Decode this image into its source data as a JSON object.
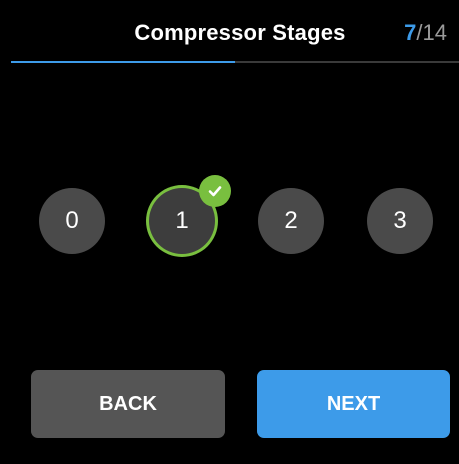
{
  "header": {
    "title": "Compressor Stages",
    "step_current": "7",
    "step_total": "/14",
    "progress_fraction": 0.5
  },
  "options": [
    {
      "label": "0",
      "selected": false
    },
    {
      "label": "1",
      "selected": true
    },
    {
      "label": "2",
      "selected": false
    },
    {
      "label": "3",
      "selected": false
    }
  ],
  "buttons": {
    "back_label": "BACK",
    "next_label": "NEXT"
  },
  "colors": {
    "accent": "#3d9be9",
    "selected": "#79bf3f"
  },
  "icons": {
    "selected_badge": "check-icon"
  }
}
